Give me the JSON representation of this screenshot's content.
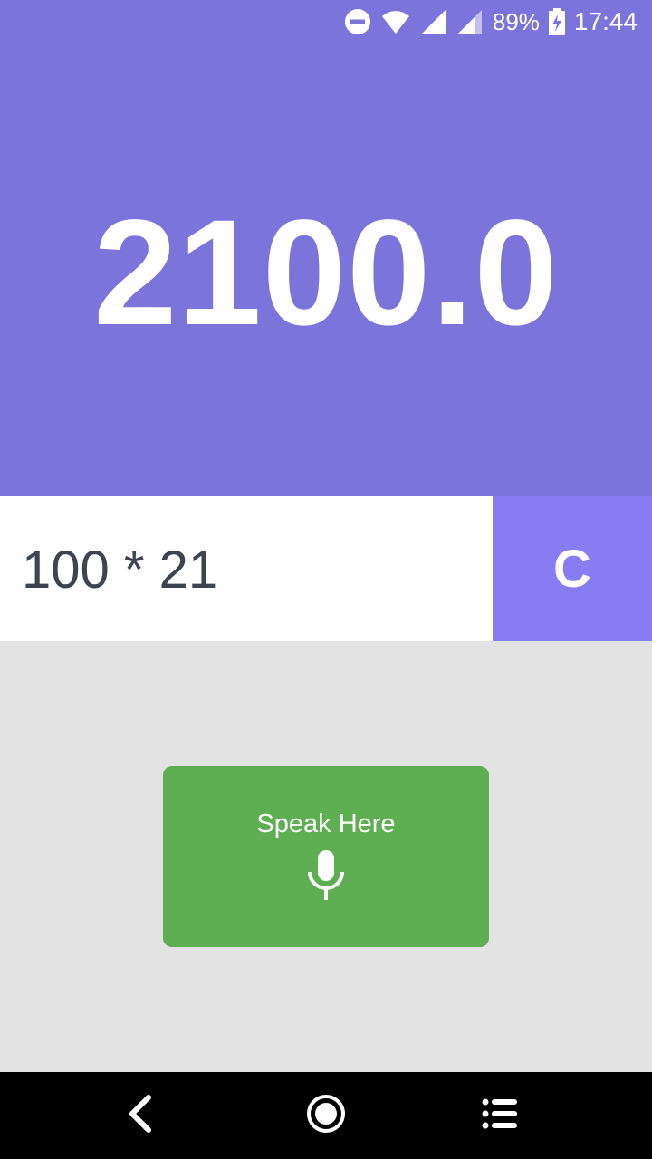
{
  "status_bar": {
    "battery_percent": "89%",
    "time": "17:44",
    "icons": [
      "do-not-disturb-icon",
      "wifi-icon",
      "signal-icon",
      "signal-icon",
      "battery-charging-icon"
    ]
  },
  "result": {
    "value": "2100.0"
  },
  "expression": {
    "text": "100 * 21",
    "clear_label": "C"
  },
  "speak": {
    "label": "Speak Here",
    "icon": "microphone-icon"
  },
  "navigation": {
    "icons": [
      "back-icon",
      "home-icon",
      "recents-icon"
    ]
  },
  "colors": {
    "result_bg": "#7b74db",
    "clear_bg": "#877cf2",
    "speak_bg": "#5daf51",
    "expression_text": "#3c4452"
  }
}
